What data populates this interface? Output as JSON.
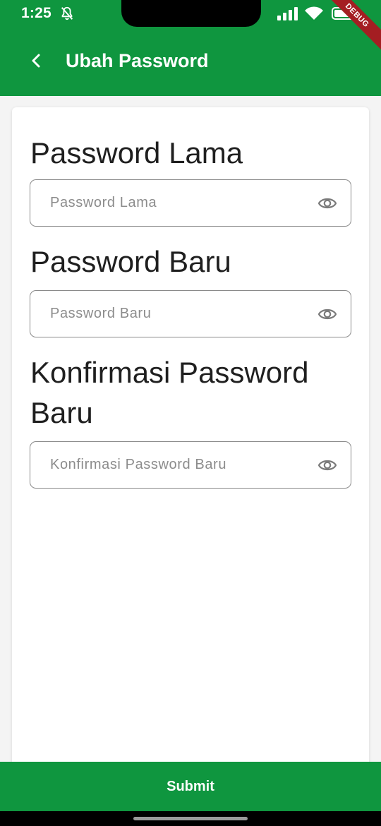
{
  "status_bar": {
    "time": "1:25",
    "icons": [
      "bell-off-icon",
      "signal-icon",
      "wifi-icon",
      "battery-icon"
    ]
  },
  "debug_banner": "DEBUG",
  "app_bar": {
    "back_icon": "chevron-left-icon",
    "title": "Ubah Password"
  },
  "form": {
    "old_password": {
      "label": "Password Lama",
      "placeholder": "Password Lama",
      "value": "",
      "toggle_icon": "eye-icon"
    },
    "new_password": {
      "label": "Password Baru",
      "placeholder": "Password Baru",
      "value": "",
      "toggle_icon": "eye-icon"
    },
    "confirm_password": {
      "label": "Konfirmasi Password Baru",
      "placeholder": "Konfirmasi Password Baru",
      "value": "",
      "toggle_icon": "eye-icon"
    }
  },
  "submit_label": "Submit",
  "colors": {
    "primary": "#0f963f",
    "debug": "#a41e22",
    "card": "#ffffff",
    "background": "#f4f4f4"
  }
}
